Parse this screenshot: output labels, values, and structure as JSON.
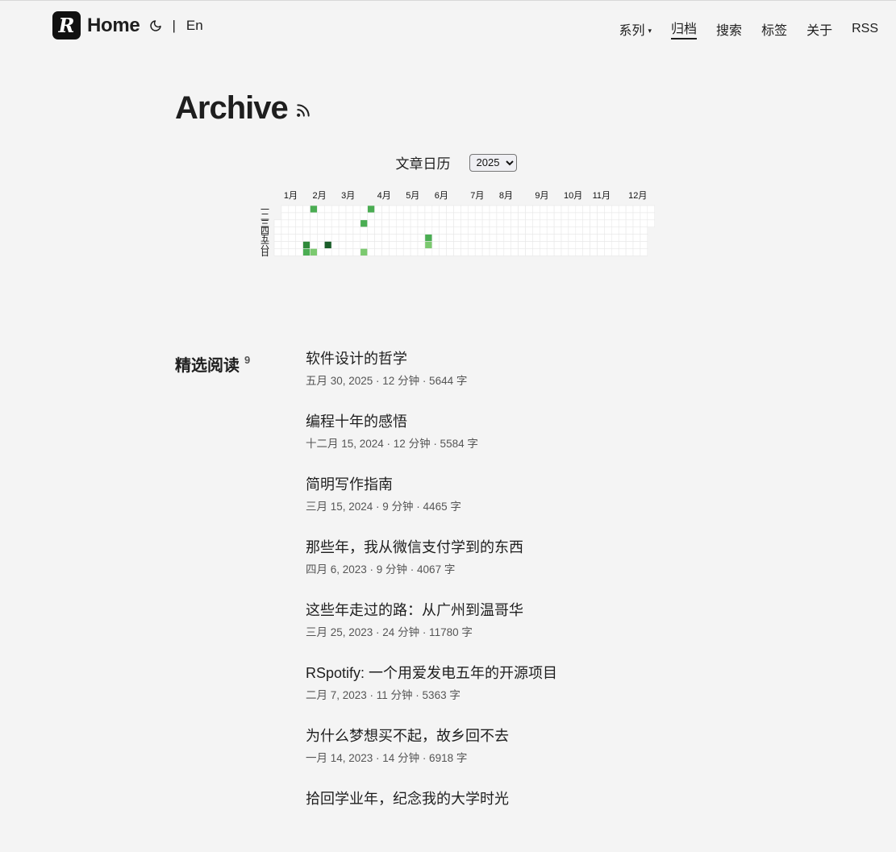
{
  "header": {
    "logo_letter": "R",
    "home_label": "Home",
    "lang_sep": "|",
    "lang_label": "En",
    "nav": [
      {
        "label": "系列",
        "has_caret": true,
        "active": false
      },
      {
        "label": "归档",
        "has_caret": false,
        "active": true
      },
      {
        "label": "搜索",
        "has_caret": false,
        "active": false
      },
      {
        "label": "标签",
        "has_caret": false,
        "active": false
      },
      {
        "label": "关于",
        "has_caret": false,
        "active": false
      },
      {
        "label": "RSS",
        "has_caret": false,
        "active": false
      }
    ],
    "caret_glyph": "▾"
  },
  "page": {
    "title": "Archive",
    "rss_icon": "rss-icon"
  },
  "calendar": {
    "title": "文章日历",
    "year_selected": "2025",
    "months": [
      "1月",
      "2月",
      "3月",
      "4月",
      "5月",
      "6月",
      "7月",
      "8月",
      "9月",
      "10月",
      "11月",
      "12月"
    ],
    "weekdays": [
      "一",
      "二",
      "三",
      "四",
      "五",
      "六",
      "日"
    ],
    "colors": {
      "empty": "#ffffff",
      "grid": "#e8e8e8",
      "level1": "#7bc96f",
      "level2": "#4aad52",
      "level3": "#2f8a3a",
      "level4": "#1b5e2a"
    },
    "posts_by_date": [
      {
        "date": "2025-02-01",
        "level": 3
      },
      {
        "date": "2025-02-02",
        "level": 2
      },
      {
        "date": "2025-02-03",
        "level": 2
      },
      {
        "date": "2025-02-09",
        "level": 1
      },
      {
        "date": "2025-02-22",
        "level": 4
      },
      {
        "date": "2025-03-26",
        "level": 2
      },
      {
        "date": "2025-03-30",
        "level": 1
      },
      {
        "date": "2025-03-31",
        "level": 2
      },
      {
        "date": "2025-05-30",
        "level": 2
      },
      {
        "date": "2025-05-31",
        "level": 1
      }
    ]
  },
  "featured": {
    "heading": "精选阅读",
    "count": "9",
    "posts": [
      {
        "title": "软件设计的哲学",
        "meta": "五月 30, 2025 · 12 分钟 · 5644 字"
      },
      {
        "title": "编程十年的感悟",
        "meta": "十二月 15, 2024 · 12 分钟 · 5584 字"
      },
      {
        "title": "简明写作指南",
        "meta": "三月 15, 2024 · 9 分钟 · 4465 字"
      },
      {
        "title": "那些年，我从微信支付学到的东西",
        "meta": "四月 6, 2023 · 9 分钟 · 4067 字"
      },
      {
        "title": "这些年走过的路：从广州到温哥华",
        "meta": "三月 25, 2023 · 24 分钟 · 11780 字"
      },
      {
        "title": "RSpotify: 一个用爱发电五年的开源项目",
        "meta": "二月 7, 2023 · 11 分钟 · 5363 字"
      },
      {
        "title": "为什么梦想买不起，故乡回不去",
        "meta": "一月 14, 2023 · 14 分钟 · 6918 字"
      },
      {
        "title": "拾回学业年，纪念我的大学时光",
        "meta": ""
      }
    ]
  }
}
